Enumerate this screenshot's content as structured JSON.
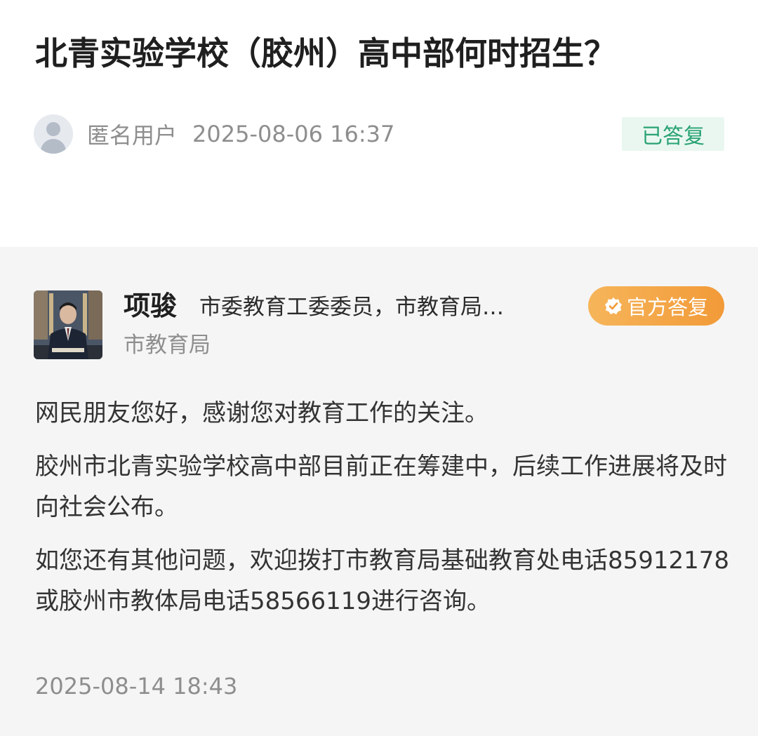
{
  "question": {
    "title": "北青实验学校（胶州）高中部何时招生？",
    "user": "匿名用户",
    "time": "2025-08-06 16:37",
    "status": "已答复"
  },
  "answer": {
    "name": "项骏",
    "title": "市委教育工委委员，市教育局…",
    "dept": "市教育局",
    "badge": "官方答复",
    "badge_icon": "verified-check-icon",
    "paragraphs": [
      "网民朋友您好，感谢您对教育工作的关注。",
      "胶州市北青实验学校高中部目前正在筹建中，后续工作进展将及时向社会公布。",
      "如您还有其他问题，欢迎拨打市教育局基础教育处电话85912178或胶州市教体局电话58566119进行咨询。"
    ],
    "time": "2025-08-14 18:43"
  },
  "colors": {
    "status_green": "#2aa374",
    "badge_orange": "#f29a38",
    "answer_bg": "#f5f5f5"
  }
}
